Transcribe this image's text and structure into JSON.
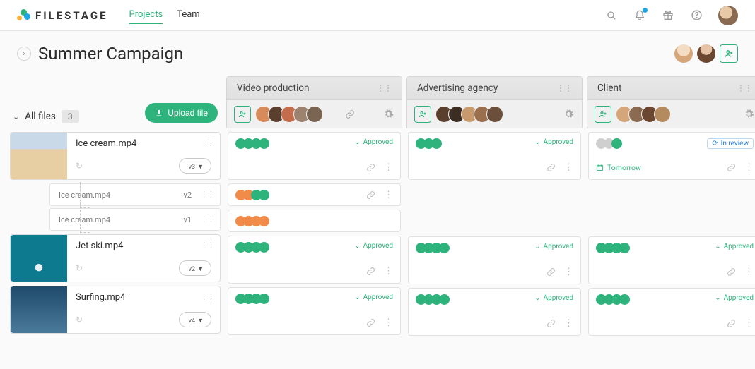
{
  "nav": {
    "brand": "FILESTAGE",
    "projects": "Projects",
    "team": "Team"
  },
  "project": {
    "title": "Summer Campaign"
  },
  "sidebar": {
    "all_files": "All files",
    "count": "3",
    "upload": "Upload file"
  },
  "files": [
    {
      "name": "Ice cream.mp4",
      "version": "v3",
      "thumb": "#c9d9e8",
      "children": [
        {
          "name": "Ice cream.mp4",
          "version": "v2"
        },
        {
          "name": "Ice cream.mp4",
          "version": "v1"
        }
      ]
    },
    {
      "name": "Jet ski.mp4",
      "version": "v2",
      "thumb": "#0d7a8f"
    },
    {
      "name": "Surfing.mp4",
      "version": "v4",
      "thumb": "#1f4a6b"
    }
  ],
  "stages": [
    {
      "name": "Video production"
    },
    {
      "name": "Advertising agency"
    },
    {
      "name": "Client"
    }
  ],
  "status": {
    "approved": "Approved",
    "in_review": "In review",
    "tomorrow": "Tomorrow"
  },
  "colors": {
    "green": "#2db37b",
    "orange": "#f08b4a",
    "grey": "#cfcfcf",
    "blue": "#2a7fd1"
  }
}
